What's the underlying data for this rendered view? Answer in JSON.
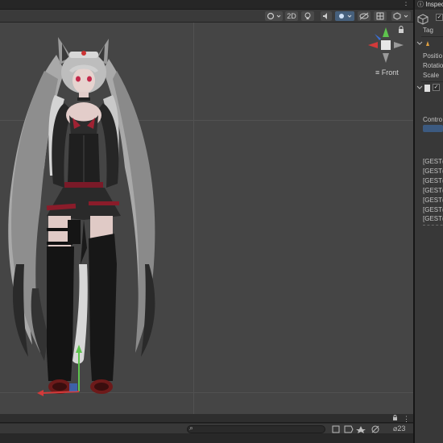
{
  "toolbar": {
    "mode_2d": "2D",
    "menu_dots": "⋮"
  },
  "gizmo": {
    "view_label": "Front"
  },
  "inspector": {
    "tab_title": "Inspec",
    "tag_label": "Tag",
    "position_label": "Positio",
    "rotation_label": "Rotatio",
    "scale_label": "Scale",
    "controller_label": "Contro",
    "gesture_items": [
      "[GEST(",
      "[GEST(",
      "[GEST(",
      "[GEST(",
      "[GEST(",
      "[GEST(",
      "[GEST("
    ]
  },
  "bottom_panel": {
    "hidden_count": "23"
  },
  "colors": {
    "viewport_bg": "#454545",
    "grid": "#515151",
    "accent_blue": "#46607c",
    "axis_x": "#d33a3a",
    "axis_y": "#5ec44e",
    "axis_z": "#3a6ed3"
  }
}
